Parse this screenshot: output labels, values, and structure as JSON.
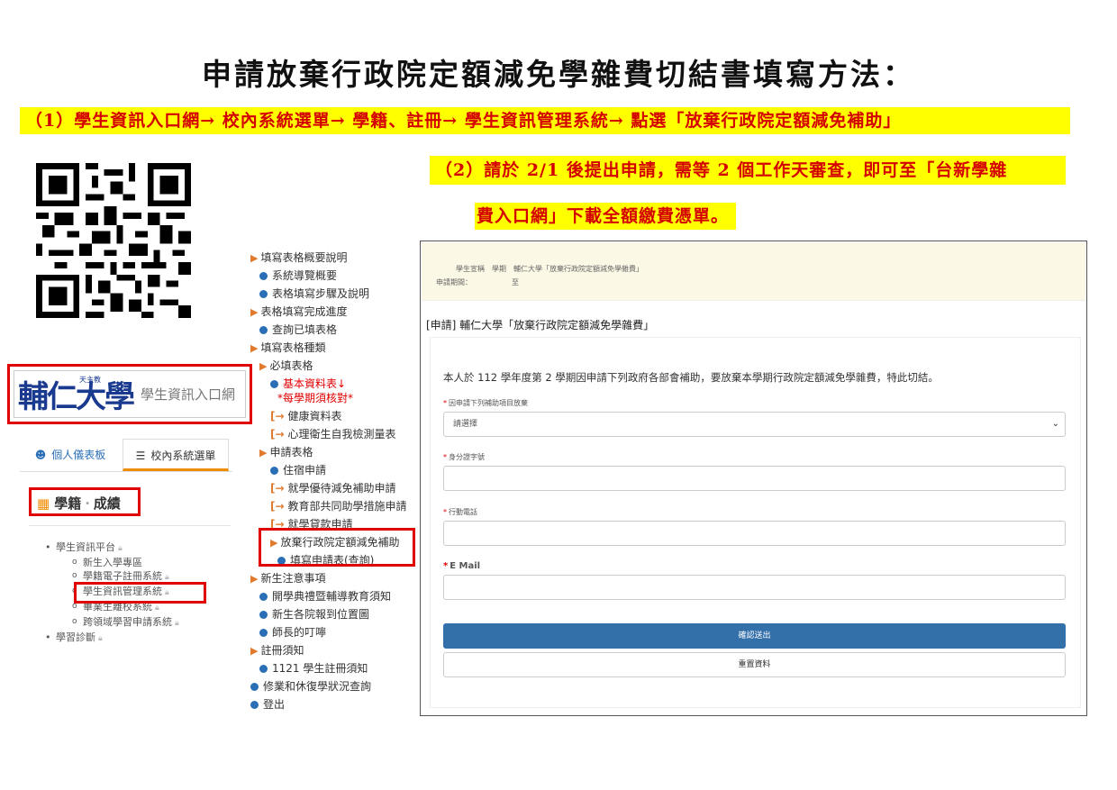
{
  "title": "申請放棄行政院定額減免學雜費切結書填寫方法：",
  "step1": "（1）學生資訊入口網→ 校內系統選單→ 學籍、註冊→ 學生資訊管理系統→ 點選「放棄行政院定額減免補助」",
  "step2_line1": "（2）請於 2/1 後提出申請，需等 2 個工作天審查，即可至「台新學雜",
  "step2_line2": "費入口網」下載全額繳費憑單。",
  "portal": {
    "logo_script": "輔仁大學",
    "logo_subtext": "天主教",
    "logo_text": "學生資訊入口網",
    "tabs": [
      "個人儀表板",
      "校內系統選單"
    ],
    "category": {
      "part1": "學籍",
      "sep": "·",
      "part2": "成績"
    },
    "tree": [
      "學生資訊平台",
      "新生入學專區",
      "學籍電子註冊系統",
      "學生資訊管理系統",
      "畢業生離校系統",
      "跨領域學習申請系統",
      "學習診斷"
    ]
  },
  "menu": [
    "填寫表格概要說明",
    "系統導覽概要",
    "表格填寫步驟及說明",
    "表格填寫完成進度",
    "查詢已填表格",
    "填寫表格種類",
    "必填表格",
    "基本資料表↓",
    "*每學期須核對*",
    "健康資料表",
    "心理衛生自我檢測量表",
    "申請表格",
    "住宿申請",
    "就學優待減免補助申請",
    "教育部共同助學措施申請",
    "就學貸款申請",
    "放棄行政院定額減免補助",
    "填寫申請表(查詢)",
    "新生注意事項",
    "開學典禮暨輔導教育須知",
    "新生各院報到位置圖",
    "師長的叮嚀",
    "註冊須知",
    "1121 學生註冊須知",
    "修業和休復學狀況查詢",
    "登出"
  ],
  "form": {
    "header_line1": "學生宣稱　學期　輔仁大學「放棄行政院定額減免學雜費」",
    "header_line2": "申請期間：　　　　　　至",
    "panel_title": "[申請] 輔仁大學「放棄行政院定額減免學雜費」",
    "statement": "本人於 112 學年度第 2 學期因申請下列政府各部會補助，要放棄本學期行政院定額減免學雜費，特此切結。",
    "field1_label": "因申請下列補助項目放棄",
    "field1_value": "請選擇",
    "field2_label": "身分證字號",
    "field3_label": "行動電話",
    "field4_label": "E Mail",
    "submit": "確認送出",
    "reset": "重置資料"
  },
  "colors": {
    "highlight": "#ffff00",
    "highlight_text": "#d40000",
    "callout_border": "#e00000",
    "primary_button": "#336fa8"
  }
}
